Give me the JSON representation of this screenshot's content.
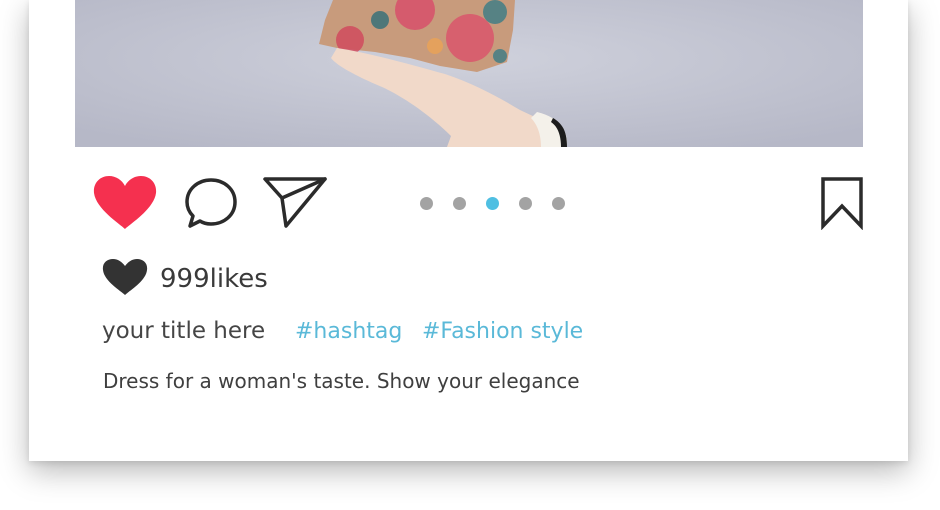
{
  "post": {
    "likes": "999likes",
    "title": "your title here",
    "hashtags": [
      "#hashtag",
      "#Fashion style"
    ],
    "description": "Dress for a woman's taste. Show your elegance"
  },
  "carousel": {
    "total": 5,
    "active_index": 2
  },
  "actions": {
    "like": "heart-icon",
    "comment": "speech-bubble-icon",
    "share": "paper-plane-icon",
    "save": "bookmark-icon"
  },
  "colors": {
    "like_active": "#f5304f",
    "hashtag": "#5ab9d8",
    "dot_active": "#4fbfe2",
    "dot_inactive": "#a3a3a3",
    "icon_stroke": "#2b2b2b"
  }
}
